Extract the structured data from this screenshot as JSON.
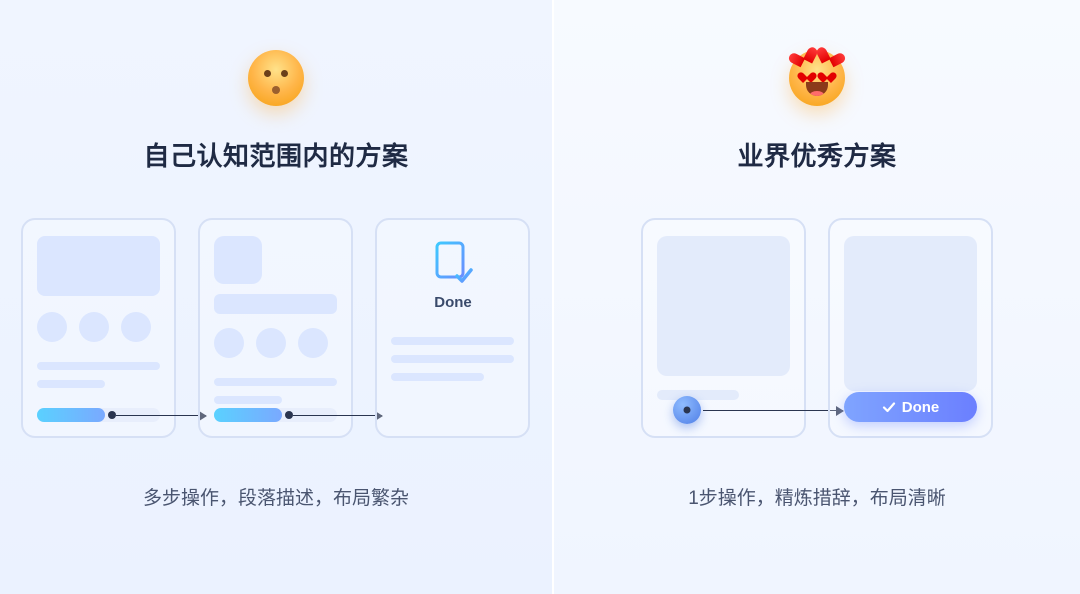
{
  "left": {
    "title": "自己认知范围内的方案",
    "done_label": "Done",
    "caption": "多步操作，段落描述，布局繁杂"
  },
  "right": {
    "title": "业界优秀方案",
    "done_button": "Done",
    "caption": "1步操作，精炼措辞，布局清晰"
  }
}
